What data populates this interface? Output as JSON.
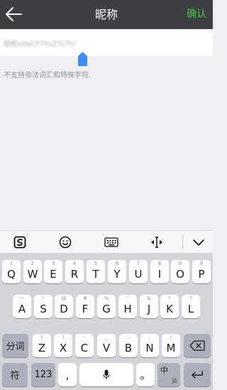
{
  "nav": {
    "title": "昵称",
    "confirm_label": "确认",
    "back_icon": "back-arrow-icon"
  },
  "nickname": {
    "value": "轻松vVaCF7YzZTCTU",
    "hint": "不支持非法词汇和特殊字符."
  },
  "toolbar": {
    "items": [
      "sogou-logo-icon",
      "emoji-icon",
      "keyboard-icon",
      "cursor-move-icon",
      "collapse-chevron-icon"
    ]
  },
  "keyboard": {
    "row1": [
      {
        "sub": "1",
        "main": "Q"
      },
      {
        "sub": "2",
        "main": "W"
      },
      {
        "sub": "3",
        "main": "E"
      },
      {
        "sub": "4",
        "main": "R"
      },
      {
        "sub": "5",
        "main": "T"
      },
      {
        "sub": "6",
        "main": "Y"
      },
      {
        "sub": "7",
        "main": "U"
      },
      {
        "sub": "8",
        "main": "I"
      },
      {
        "sub": "9",
        "main": "O"
      },
      {
        "sub": "0",
        "main": "P"
      }
    ],
    "row2": [
      {
        "sub": "~",
        "main": "A"
      },
      {
        "sub": "!",
        "main": "S"
      },
      {
        "sub": "@",
        "main": "D"
      },
      {
        "sub": "#",
        "main": "F"
      },
      {
        "sub": "%",
        "main": "G"
      },
      {
        "sub": "'",
        "main": "H"
      },
      {
        "sub": "&",
        "main": "J"
      },
      {
        "sub": "*",
        "main": "K"
      },
      {
        "sub": "?",
        "main": "L"
      }
    ],
    "row3": [
      {
        "sub": "(",
        "main": "Z"
      },
      {
        "sub": ")",
        "main": "X"
      },
      {
        "sub": "-",
        "main": "C"
      },
      {
        "sub": "_",
        "main": "V"
      },
      {
        "sub": ":",
        "main": "B"
      },
      {
        "sub": ";",
        "main": "N"
      },
      {
        "sub": "/",
        "main": "M"
      }
    ],
    "segment_label": "分词",
    "symbol_label": "符",
    "numbers_label": "123",
    "comma_label": ",",
    "period_label": "。",
    "lang_top": "中",
    "lang_bottom": "英",
    "delete_icon": "backspace-icon",
    "space_icon": "microphone-icon",
    "return_icon": "return-icon"
  },
  "colors": {
    "nav_bg": "#3d3f44",
    "confirm_green": "#4cc14a",
    "cursor_handle_blue": "#3d8df5"
  }
}
